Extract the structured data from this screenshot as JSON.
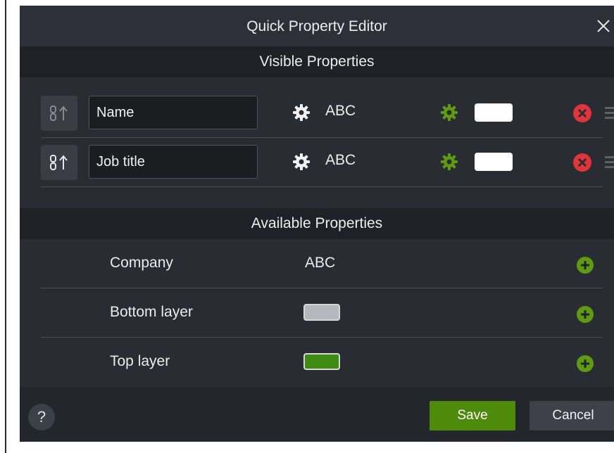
{
  "dialog": {
    "title": "Quick Property Editor",
    "close_icon": "close-icon"
  },
  "visible": {
    "header": "Visible Properties",
    "rows": [
      {
        "field_value": "Name",
        "type_label": "ABC",
        "color_swatch": "#ffffff",
        "link_icon": "link-toggle-icon"
      },
      {
        "field_value": "Job title",
        "type_label": "ABC",
        "color_swatch": "#ffffff",
        "link_icon": "link-toggle-icon"
      }
    ]
  },
  "available": {
    "header": "Available Properties",
    "rows": [
      {
        "label": "Company",
        "value": "ABC"
      },
      {
        "label": "Bottom layer",
        "color": "#b5b8bc"
      },
      {
        "label": "Top layer",
        "color": "#3f8a12"
      }
    ]
  },
  "footer": {
    "help_label": "?",
    "save_label": "Save",
    "cancel_label": "Cancel"
  },
  "colors": {
    "accent_green": "#5f9b12",
    "remove_red": "#e0353a",
    "dialog_bg": "#292c33"
  }
}
